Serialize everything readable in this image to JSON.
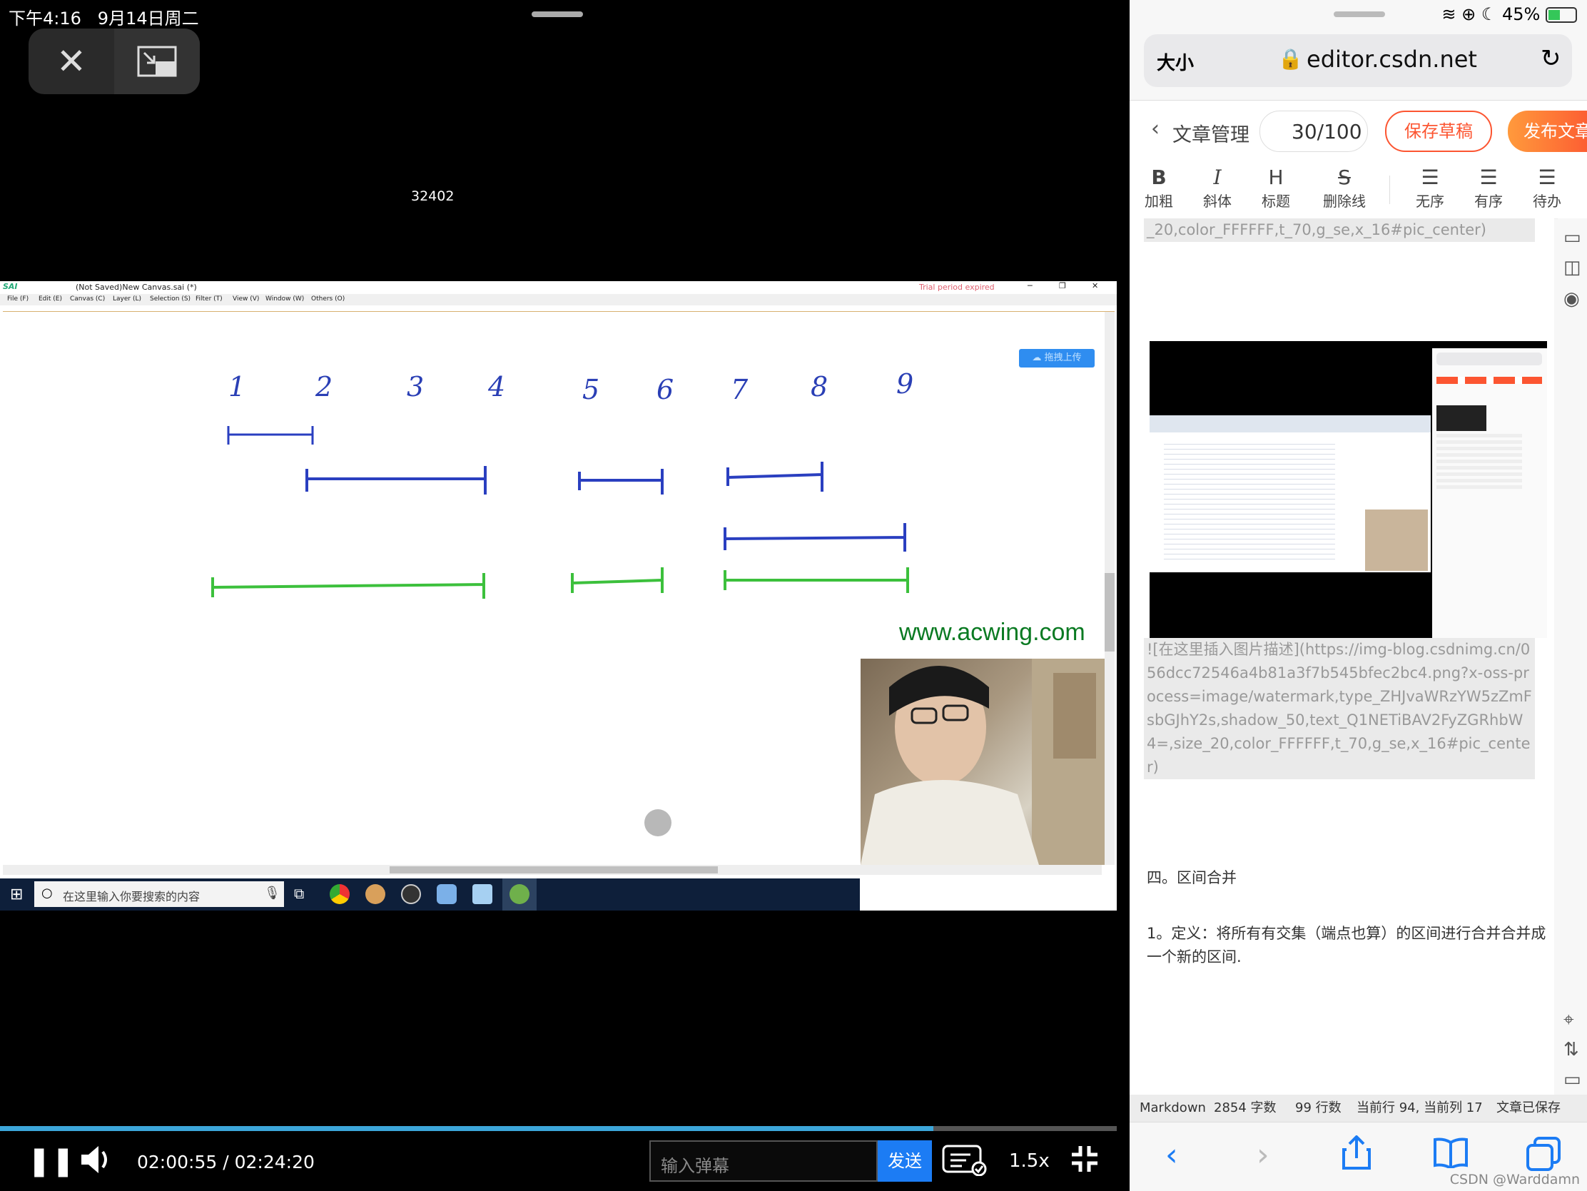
{
  "status_bar": {
    "time": "下午4:16",
    "date": "9月14日周二",
    "battery": "45%"
  },
  "pip": {
    "close_icon": "close-icon",
    "pip_icon": "picture-in-picture-icon",
    "stream_id": "32402"
  },
  "sai": {
    "title": "(Not Saved)New Canvas.sai (*)",
    "logo": "SAI",
    "trial_notice": "Trial period expired",
    "menu": [
      "File (F)",
      "Edit (E)",
      "Canvas (C)",
      "Layer (L)",
      "Selection (S)",
      "Filter (T)",
      "View (V)",
      "Window (W)",
      "Others (O)"
    ],
    "upload_badge": "拖拽上传",
    "watermark": "www.acwing.com",
    "handwritten_numbers": [
      "1",
      "2",
      "3",
      "4",
      "5",
      "6",
      "7",
      "8",
      "9"
    ]
  },
  "taskbar": {
    "search_placeholder": "在这里输入你要搜索的内容"
  },
  "player": {
    "time": "02:00:55 / 02:24:20",
    "danmaku_placeholder": "输入弹幕",
    "send_label": "发送",
    "speed": "1.5x",
    "progress": 0.836,
    "colors": {
      "progress": "#3ca6d9",
      "send": "#1c7cf4"
    }
  },
  "safari": {
    "text_size": "大小",
    "url": "editor.csdn.net"
  },
  "csdn": {
    "back_label": "文章管理",
    "title_count": "30/100",
    "save_draft": "保存草稿",
    "publish": "发布文章",
    "toolbar": [
      {
        "glyph": "B",
        "label": "加粗"
      },
      {
        "glyph": "I",
        "label": "斜体"
      },
      {
        "glyph": "H",
        "label": "标题"
      },
      {
        "glyph": "S",
        "label": "删除线"
      },
      {
        "glyph": "☰",
        "label": "无序"
      },
      {
        "glyph": "☰",
        "label": "有序"
      },
      {
        "glyph": "☰",
        "label": "待办"
      }
    ],
    "md_top": "_20,color_FFFFFF,t_70,g_se,x_16#pic_center)",
    "md_image_block": "![在这里插入图片描述](https://img-blog.csdnimg.cn/056dcc72546a4b81a3f7b545bfec2bc4.png?x-oss-process=image/watermark,type_ZHJvaWRzYW5zZmFsbGJhY2s,shadow_50,text_Q1NETiBAV2FyZGRhbW4=,size_20,color_FFFFFF,t_70,g_se,x_16#pic_center)",
    "section_heading": "四。区间合并",
    "definition": "1。定义：将所有有交集（端点也算）的区间进行合并合并成一个新的区间.",
    "status": {
      "mode": "Markdown",
      "chars": "2854 字数",
      "lines": "99 行数",
      "cursor": "当前行 94, 当前列 17",
      "saved": "文章已保存"
    },
    "brand_color": "#fc5531"
  },
  "watermark_footer": "CSDN @Warddamn"
}
